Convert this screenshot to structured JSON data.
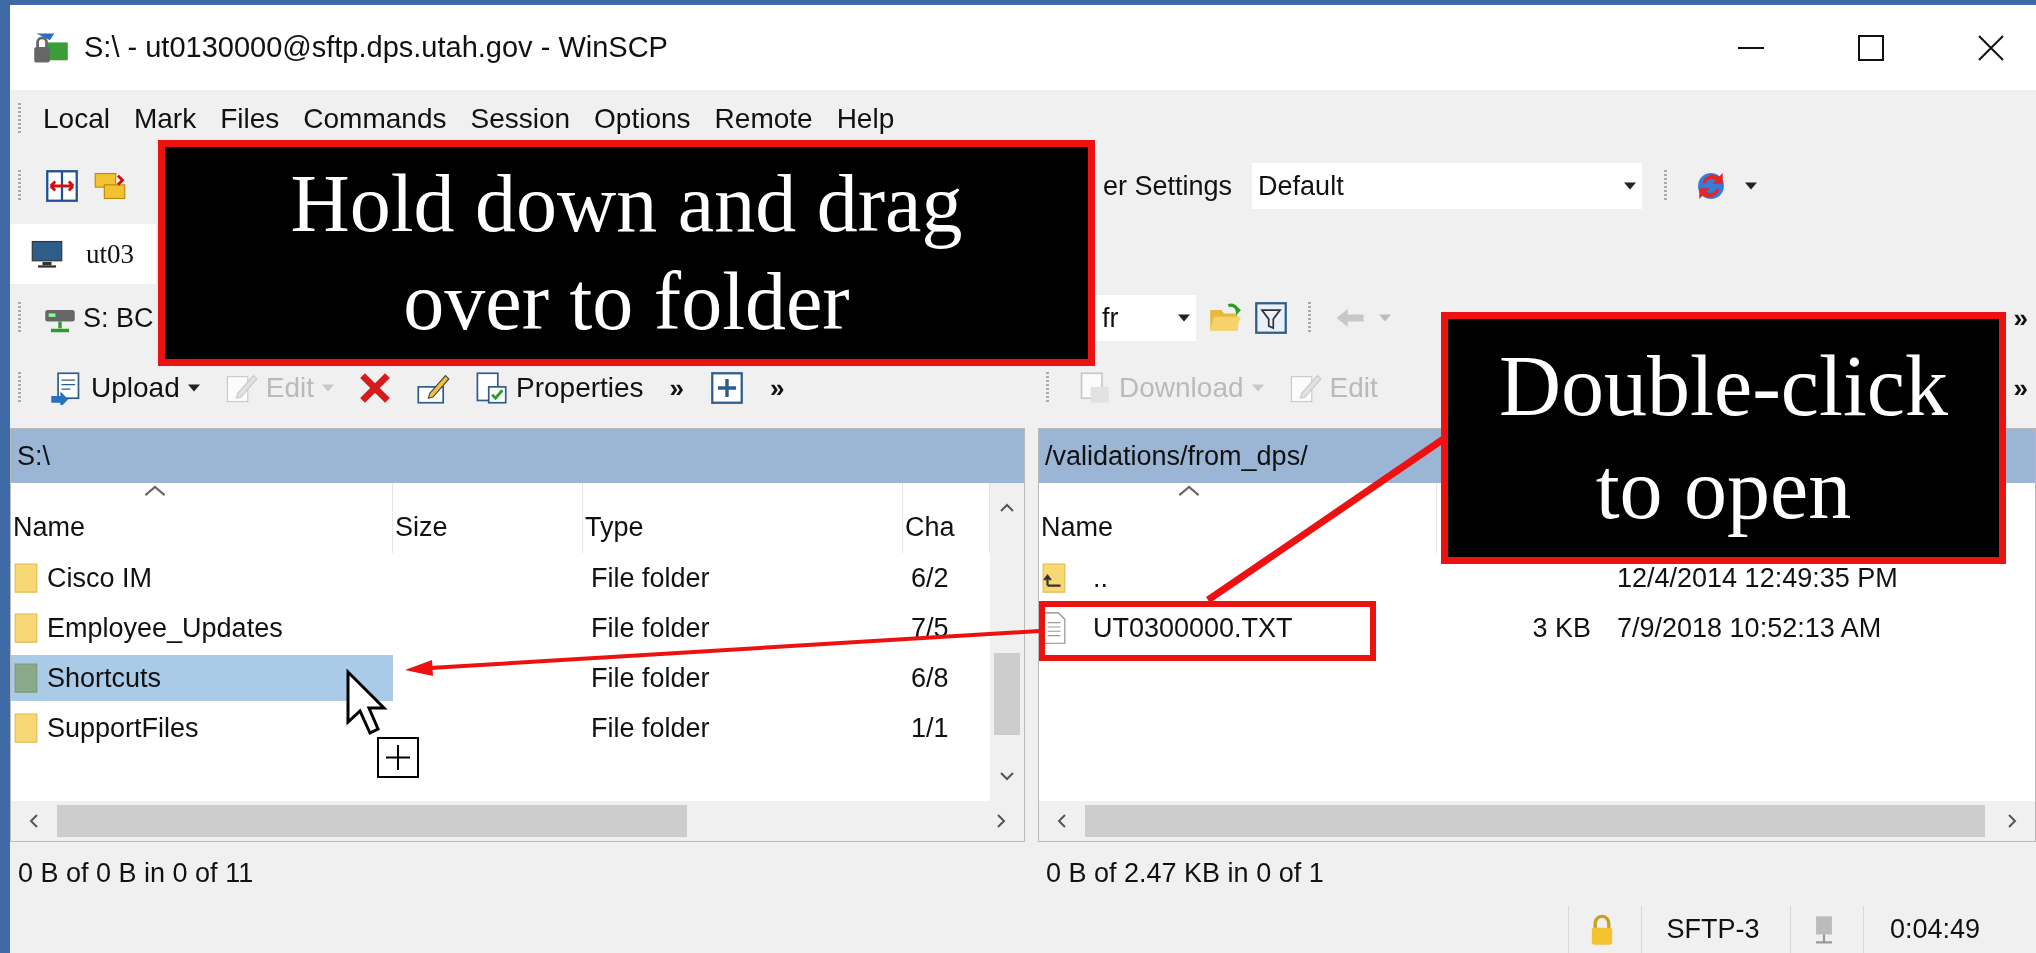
{
  "window": {
    "title": "S:\\ - ut0130000@sftp.dps.utah.gov - WinSCP"
  },
  "menu": [
    "Local",
    "Mark",
    "Files",
    "Commands",
    "Session",
    "Options",
    "Remote",
    "Help"
  ],
  "toolbar": {
    "settings_label": "er Settings",
    "settings_value": "Default"
  },
  "session_tab": {
    "label": "ut03"
  },
  "local": {
    "drive": "S: BC",
    "buttons": [
      {
        "kind": "upload",
        "label": "Upload",
        "disabled": false,
        "dropdown": true
      },
      {
        "kind": "edit",
        "label": "Edit",
        "disabled": true,
        "dropdown": true
      },
      {
        "kind": "delete",
        "disabled": false,
        "dropdown": false
      },
      {
        "kind": "rename",
        "disabled": false,
        "dropdown": false
      },
      {
        "kind": "properties",
        "label": "Properties",
        "disabled": false,
        "dropdown": false
      },
      {
        "kind": "overflow",
        "label": "»"
      },
      {
        "kind": "new",
        "disabled": false,
        "dropdown": false
      },
      {
        "kind": "overflow",
        "label": "»"
      }
    ],
    "path": "S:\\",
    "columns": [
      {
        "label": "Name",
        "sorted": true
      },
      {
        "label": "Size",
        "sorted": false
      },
      {
        "label": "Type",
        "sorted": false
      },
      {
        "label": "Cha",
        "sorted": false
      }
    ],
    "rows": [
      {
        "kind": "folder",
        "name": "Cisco IM",
        "type": "File folder",
        "changed": "6/2",
        "selected": false
      },
      {
        "kind": "folder",
        "name": "Employee_Updates",
        "type": "File folder",
        "changed": "7/5",
        "selected": false
      },
      {
        "kind": "folder",
        "name": "Shortcuts",
        "type": "File folder",
        "changed": "6/8",
        "selected": true
      },
      {
        "kind": "folder",
        "name": "SupportFiles",
        "type": "File folder",
        "changed": "1/1",
        "selected": false
      }
    ],
    "status": "0 B of 0 B in 0 of 11"
  },
  "remote": {
    "path_combo": "fr",
    "address_overflow": "»",
    "buttons": [
      {
        "kind": "download",
        "label": "Download",
        "disabled": true,
        "dropdown": true
      },
      {
        "kind": "edit",
        "label": "Edit",
        "disabled": true,
        "dropdown": false
      }
    ],
    "toolbar_overflow": "»",
    "path": "/validations/from_dps/",
    "columns": [
      {
        "label": "Name",
        "sorted": true
      }
    ],
    "rows": [
      {
        "kind": "parent",
        "name": "..",
        "changed": "12/4/2014 12:49:35 PM",
        "selected": false
      },
      {
        "kind": "file",
        "name": "UT0300000.TXT",
        "size": "3 KB",
        "changed": "7/9/2018 10:52:13 AM",
        "selected": false
      }
    ],
    "status": "0 B of 2.47 KB in 0 of 1"
  },
  "status_bar": {
    "protocol": "SFTP-3",
    "elapsed": "0:04:49"
  },
  "annotations": [
    {
      "lines": [
        "Hold down and drag",
        "over to folder"
      ]
    },
    {
      "lines": [
        "Double-click",
        "to open"
      ]
    }
  ]
}
